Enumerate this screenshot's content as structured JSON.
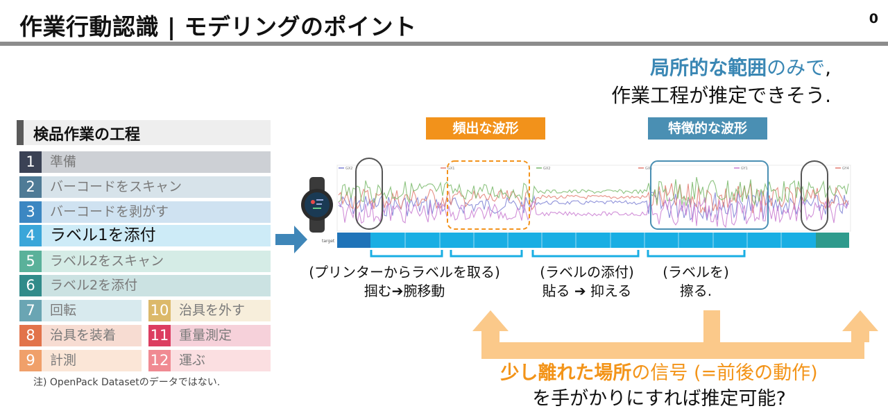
{
  "header": {
    "title": "作業行動認識 | モデリングのポイント",
    "page_number": "0"
  },
  "headline": {
    "line1_bold": "局所的な範囲",
    "line1_normal": "のみで",
    "line1_end": ",",
    "line2": "作業工程が推定できそう."
  },
  "process": {
    "heading": "検品作業の工程",
    "steps": [
      {
        "num": "1",
        "label": "準備",
        "color": "#3b4255",
        "bg": "#cdd0d5"
      },
      {
        "num": "2",
        "label": "バーコードをスキャン",
        "color": "#4f7b96",
        "bg": "#d7e3ea"
      },
      {
        "num": "3",
        "label": "バーコードを剥がす",
        "color": "#3c87c2",
        "bg": "#cfe2f1"
      },
      {
        "num": "4",
        "label": "ラベル1を添付",
        "color": "#3aa6d9",
        "bg": "#cdebf7"
      },
      {
        "num": "5",
        "label": "ラベル2をスキャン",
        "color": "#5ab19a",
        "bg": "#d5ece6"
      },
      {
        "num": "6",
        "label": "ラベル2を添付",
        "color": "#318b8a",
        "bg": "#cbe2e2"
      },
      {
        "num": "7",
        "label": "回転",
        "color": "#6aa5b3",
        "bg": "#d8eaee"
      },
      {
        "num": "8",
        "label": "治具を装着",
        "color": "#e2734a",
        "bg": "#f7dcd2"
      },
      {
        "num": "9",
        "label": "計測",
        "color": "#f0a06a",
        "bg": "#fbe6d7"
      },
      {
        "num": "10",
        "label": "治具を外す",
        "color": "#dcb96a",
        "bg": "#f7eedb"
      },
      {
        "num": "11",
        "label": "重量測定",
        "color": "#dc3d60",
        "bg": "#f6d1da"
      },
      {
        "num": "12",
        "label": "運ぶ",
        "color": "#f08a92",
        "bg": "#fbdfe1"
      }
    ],
    "note": "注) OpenPack Datasetのデータではない."
  },
  "tags": {
    "frequent": "頻出な波形",
    "characteristic": "特徴的な波形"
  },
  "plot": {
    "legend": [
      "GX2",
      "GX1",
      "GX2",
      "GX1",
      "GY1",
      "GY4"
    ],
    "target_label": "target",
    "series_colors": [
      "#7b7fd4",
      "#e27b70",
      "#79b86a",
      "#c97bd1"
    ],
    "target_colors": [
      "#1f73b8",
      "#19aee3",
      "#2e9a8c"
    ]
  },
  "captions": {
    "c1_line1": "(プリンターからラベルを取る)",
    "c1_line2": "掴む➔腕移動",
    "c2_line1": "(ラベルの添付)",
    "c2_line2": "貼る ➔ 抑える",
    "c3_line1": "(ラベルを)",
    "c3_line2": "擦る."
  },
  "bottom": {
    "bold": "少し離れた場所",
    "normal": "の信号 (=前後の動作)",
    "line2": "を手がかりにすれば推定可能?"
  }
}
